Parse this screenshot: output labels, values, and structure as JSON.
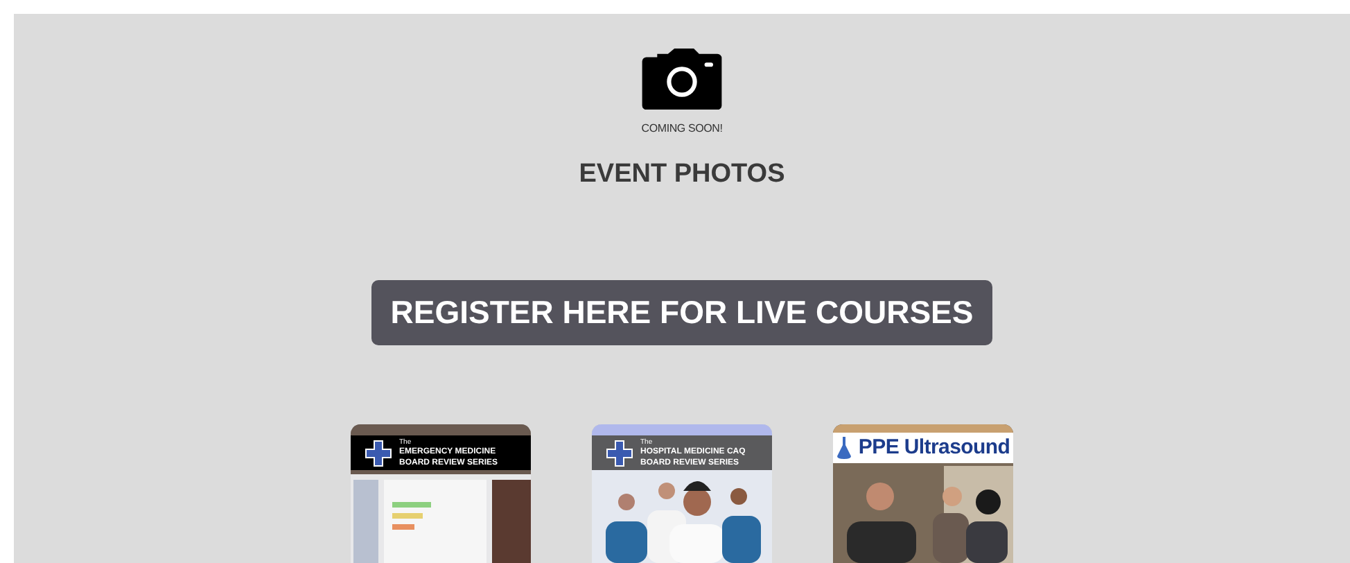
{
  "photos": {
    "caption": "COMING SOON!",
    "heading": "EVENT PHOTOS"
  },
  "register_button": {
    "label": "REGISTER HERE FOR LIVE COURSES"
  },
  "courses": [
    {
      "kind": "dark",
      "prefix": "The",
      "title": "EMERGENCY MEDICINE",
      "subtitle": "BOARD REVIEW SERIES"
    },
    {
      "kind": "grey",
      "prefix": "The",
      "title": "HOSPITAL MEDICINE CAQ",
      "subtitle": "BOARD REVIEW SERIES"
    },
    {
      "kind": "brand",
      "title": "PPE Ultrasound"
    }
  ]
}
